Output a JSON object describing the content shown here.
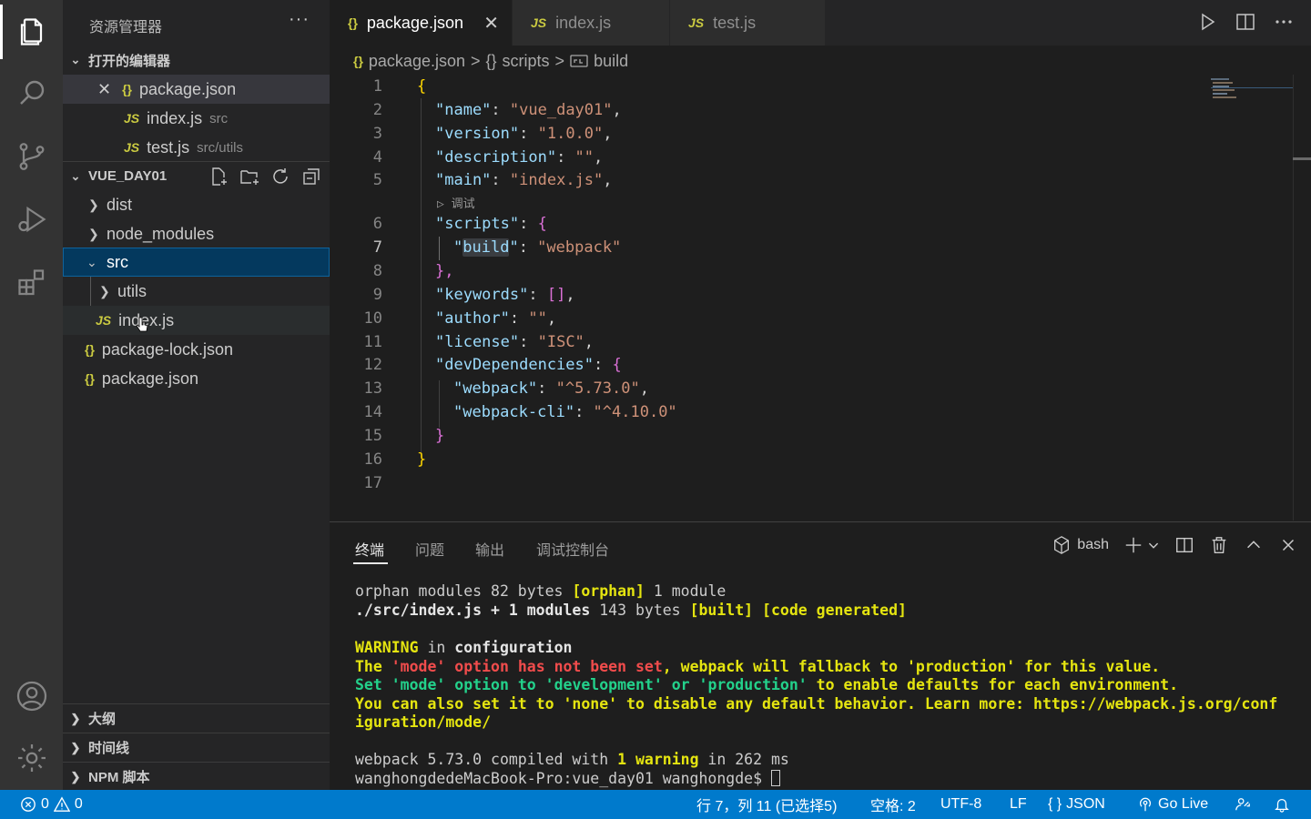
{
  "sidebar": {
    "title": "资源管理器",
    "more": "···",
    "open_editors": {
      "header": "打开的编辑器",
      "items": [
        {
          "icon": "{}",
          "name": "package.json",
          "path": ""
        },
        {
          "icon": "JS",
          "name": "index.js",
          "path": "src"
        },
        {
          "icon": "JS",
          "name": "test.js",
          "path": "src/utils"
        }
      ]
    },
    "project": {
      "header": "VUE_DAY01",
      "tree": [
        {
          "name": "dist",
          "type": "folder"
        },
        {
          "name": "node_modules",
          "type": "folder"
        },
        {
          "name": "src",
          "type": "folder-open"
        },
        {
          "name": "utils",
          "type": "folder"
        },
        {
          "name": "index.js",
          "type": "js"
        },
        {
          "name": "package-lock.json",
          "type": "json"
        },
        {
          "name": "package.json",
          "type": "json"
        }
      ]
    },
    "bottom_sections": [
      "大纲",
      "时间线",
      "NPM 脚本"
    ]
  },
  "tabs": [
    {
      "icon": "{}",
      "label": "package.json",
      "active": true
    },
    {
      "icon": "JS",
      "label": "index.js",
      "active": false
    },
    {
      "icon": "JS",
      "label": "test.js",
      "active": false
    }
  ],
  "breadcrumb": {
    "file": "package.json",
    "scripts": "scripts",
    "build": "build",
    "json_icon": "{}",
    "scripts_icon": "{}",
    "sep": ">"
  },
  "editor": {
    "line_numbers": [
      "1",
      "2",
      "3",
      "4",
      "5",
      "6",
      "7",
      "8",
      "9",
      "10",
      "11",
      "12",
      "13",
      "14",
      "15",
      "16",
      "17"
    ],
    "codelens": "▷ 调试",
    "lines": {
      "l1_brace": "{",
      "name_key": "\"name\"",
      "name_val": "\"vue_day01\"",
      "version_key": "\"version\"",
      "version_val": "\"1.0.0\"",
      "desc_key": "\"description\"",
      "desc_val": "\"\"",
      "main_key": "\"main\"",
      "main_val": "\"index.js\"",
      "scripts_key": "\"scripts\"",
      "build_q1": "\"",
      "build_word": "build",
      "build_q2": "\"",
      "build_val": "\"webpack\"",
      "keywords_key": "\"keywords\"",
      "keywords_val": "[]",
      "author_key": "\"author\"",
      "author_val": "\"\"",
      "license_key": "\"license\"",
      "license_val": "\"ISC\"",
      "devdeps_key": "\"devDependencies\"",
      "webpack_key": "\"webpack\"",
      "webpack_val": "\"^5.73.0\"",
      "webpackcli_key": "\"webpack-cli\"",
      "webpackcli_val": "\"^4.10.0\"",
      "colon": ": ",
      "comma": ",",
      "open_brace": "{",
      "close_brace_comma": "},",
      "close_brace": "}"
    }
  },
  "panel": {
    "tabs": [
      "终端",
      "问题",
      "输出",
      "调试控制台"
    ],
    "shell": "bash",
    "terminal": {
      "l1a": "orphan modules 82 bytes ",
      "l1b": "[orphan]",
      "l1c": " 1 module",
      "l2a": "./src/index.js + 1 modules",
      "l2b": " 143 bytes ",
      "l2c": "[built] [code generated]",
      "l3a": "WARNING",
      "l3b": " in ",
      "l3c": "configuration",
      "l4a": "The ",
      "l4b": "'mode'",
      "l4c": " option has not been set",
      "l4d": ", webpack will fallback to 'production' for this value.",
      "l5a": "Set ",
      "l5b": "'mode'",
      "l5c": " option to ",
      "l5d": "'development'",
      "l5e": " or ",
      "l5f": "'production'",
      "l5g": " to enable defaults for each environment.",
      "l6": "You can also set it to 'none' to disable any default behavior. Learn more: https://webpack.js.org/conf",
      "l7": "iguration/mode/",
      "l8a": "webpack 5.73.0 compiled with ",
      "l8b": "1 warning",
      "l8c": " in 262 ms",
      "l9": "wanghongdedeMacBook-Pro:vue_day01 wanghongde$ "
    }
  },
  "statusbar": {
    "errors": "0",
    "warnings": "0",
    "position": "行 7，列 11 (已选择5)",
    "spaces": "空格: 2",
    "encoding": "UTF-8",
    "eol": "LF",
    "language": "JSON",
    "golive": "Go Live"
  },
  "colors": {
    "statusbar": "#007acc",
    "activitybar": "#333333",
    "sidebar": "#252526",
    "editor": "#1e1e1e",
    "json_key": "#9cdcfe",
    "json_string": "#ce9178"
  }
}
